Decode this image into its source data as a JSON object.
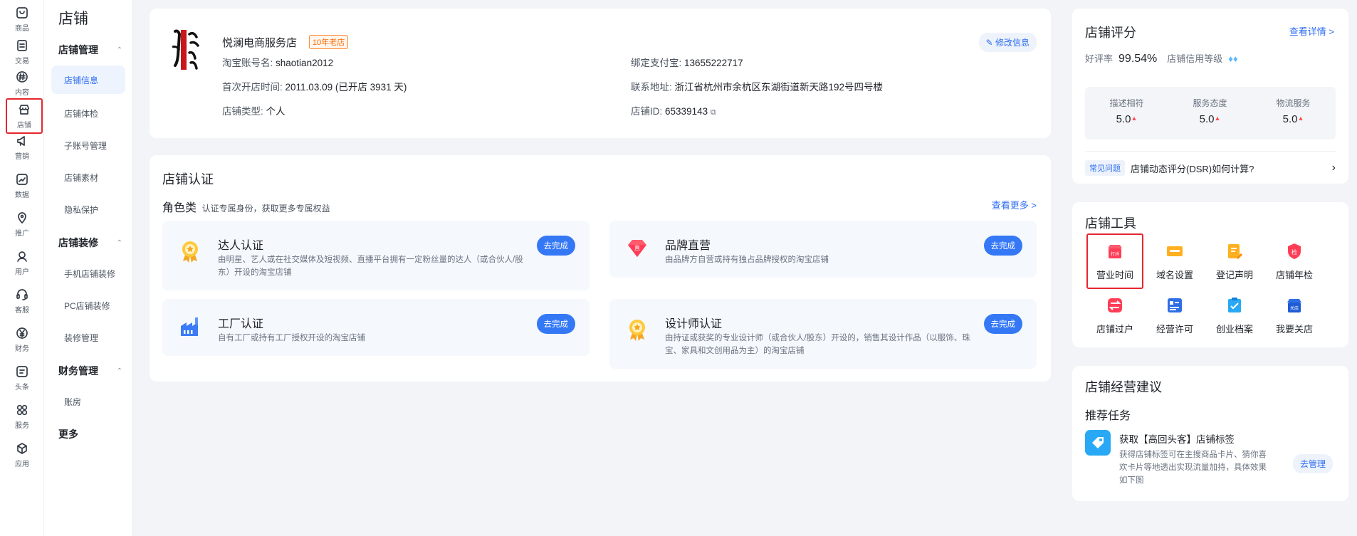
{
  "rail": [
    {
      "label": "商品",
      "icon": "product-icon"
    },
    {
      "label": "交易",
      "icon": "trade-icon"
    },
    {
      "label": "内容",
      "icon": "content-icon"
    },
    {
      "label": "店铺",
      "icon": "store-icon"
    },
    {
      "label": "营销",
      "icon": "marketing-icon"
    },
    {
      "label": "数据",
      "icon": "data-icon"
    },
    {
      "label": "推广",
      "icon": "promotion-icon"
    },
    {
      "label": "用户",
      "icon": "user-icon"
    },
    {
      "label": "客服",
      "icon": "customer-service-icon"
    },
    {
      "label": "财务",
      "icon": "finance-icon"
    },
    {
      "label": "头条",
      "icon": "headline-icon"
    },
    {
      "label": "服务",
      "icon": "service-icon"
    },
    {
      "label": "应用",
      "icon": "apps-icon"
    }
  ],
  "subnav": {
    "title": "店铺",
    "group_manage": "店铺管理",
    "items_manage": [
      "店铺信息",
      "店铺体检",
      "子账号管理",
      "店铺素材",
      "隐私保护"
    ],
    "group_decor": "店铺装修",
    "items_decor": [
      "手机店铺装修",
      "PC店铺装修",
      "装修管理"
    ],
    "group_finance": "财务管理",
    "items_finance": [
      "账房"
    ],
    "more": "更多"
  },
  "shop": {
    "name": "悦澜电商服务店",
    "badge": "10年老店",
    "edit": "修改信息",
    "account_label": "淘宝账号名:",
    "account": "shaotian2012",
    "alipay_label": "绑定支付宝:",
    "alipay": "13655222717",
    "open_label": "首次开店时间:",
    "open": "2011.03.09 (已开店 3931 天)",
    "address_label": "联系地址:",
    "address": "浙江省杭州市余杭区东湖街道新天路192号四号楼",
    "type_label": "店铺类型:",
    "type": "个人",
    "id_label": "店铺ID:",
    "id": "65339143"
  },
  "cert": {
    "title": "店铺认证",
    "subtitle": "角色类",
    "subdesc": "认证专属身份，获取更多专属权益",
    "more": "查看更多 >",
    "go": "去完成",
    "items": [
      {
        "title": "达人认证",
        "desc": "由明星、艺人或在社交媒体及短视频、直播平台拥有一定粉丝量的达人（或合伙人/股东）开设的淘宝店铺",
        "icon": "talent-medal-icon"
      },
      {
        "title": "品牌直营",
        "desc": "由品牌方自营或持有独占品牌授权的淘宝店铺",
        "icon": "brand-direct-icon"
      },
      {
        "title": "工厂认证",
        "desc": "自有工厂或持有工厂授权开设的淘宝店铺",
        "icon": "factory-icon"
      },
      {
        "title": "设计师认证",
        "desc": "由持证或获奖的专业设计师（或合伙人/股东）开设的，销售其设计作品（以服饰、珠宝、家具和文创用品为主）的淘宝店铺",
        "icon": "designer-medal-icon"
      }
    ]
  },
  "rating": {
    "title": "店铺评分",
    "details": "查看详情 >",
    "good_label": "好评率",
    "good": "99.54%",
    "credit_label": "店铺信用等级",
    "dsr": [
      {
        "label": "描述相符",
        "value": "5.0"
      },
      {
        "label": "服务态度",
        "value": "5.0"
      },
      {
        "label": "物流服务",
        "value": "5.0"
      }
    ],
    "faq_tag": "常见问题",
    "faq": "店铺动态评分(DSR)如何计算?"
  },
  "tools": {
    "title": "店铺工具",
    "items": [
      {
        "label": "营业时间",
        "icon": "business-hours-icon",
        "glyph": "打烊"
      },
      {
        "label": "域名设置",
        "icon": "domain-settings-icon",
        "glyph": ""
      },
      {
        "label": "登记声明",
        "icon": "registration-statement-icon",
        "glyph": ""
      },
      {
        "label": "店铺年检",
        "icon": "annual-inspection-icon",
        "glyph": "检"
      },
      {
        "label": "店铺过户",
        "icon": "store-transfer-icon",
        "glyph": ""
      },
      {
        "label": "经营许可",
        "icon": "business-license-icon",
        "glyph": ""
      },
      {
        "label": "创业档案",
        "icon": "startup-archive-icon",
        "glyph": ""
      },
      {
        "label": "我要关店",
        "icon": "close-store-icon",
        "glyph": "关店"
      }
    ]
  },
  "advice": {
    "title": "店铺经营建议",
    "subtitle": "推荐任务",
    "task_title": "获取【高回头客】店铺标签",
    "task_desc": "获得店铺标签可在主搜商品卡片、猜你喜欢卡片等地透出实现流量加持，具体效果如下图",
    "manage": "去管理"
  }
}
